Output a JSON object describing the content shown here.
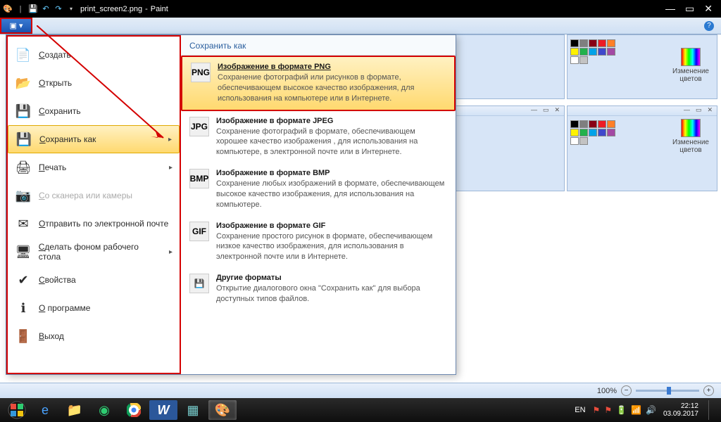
{
  "window": {
    "title_separator": "|",
    "filename": "print_screen2.png",
    "appname": "Paint"
  },
  "qat": {
    "save": "💾",
    "undo": "↶",
    "redo": "↷",
    "customize": "▾"
  },
  "win_controls": {
    "min": "—",
    "max": "▭",
    "close": "✕"
  },
  "file_button": {
    "glyph": "▣ ▾"
  },
  "help_icon": "?",
  "appmenu": {
    "items": [
      {
        "label": "Создать",
        "icon": "📄"
      },
      {
        "label": "Открыть",
        "icon": "📂"
      },
      {
        "label": "Сохранить",
        "icon": "💾"
      },
      {
        "label": "Сохранить как",
        "icon": "💾",
        "selected": true,
        "has_arrow": true
      },
      {
        "label": "Печать",
        "icon": "🖨",
        "has_arrow": true
      },
      {
        "label": "Со сканера или камеры",
        "icon": "📷",
        "disabled": true
      },
      {
        "label": "Отправить по электронной почте",
        "icon": "✉"
      },
      {
        "label": "Сделать фоном рабочего стола",
        "icon": "🖥",
        "has_arrow": true
      },
      {
        "label": "Свойства",
        "icon": "✔"
      },
      {
        "label": "О программе",
        "icon": "ℹ"
      },
      {
        "label": "Выход",
        "icon": "🚪"
      }
    ],
    "sub_header": "Сохранить как",
    "formats": [
      {
        "title": "Изображение в формате PNG",
        "desc": "Сохранение фотографий или рисунков в формате, обеспечивающем высокое качество изображения, для использования на компьютере или в Интернете.",
        "icon": "PNG",
        "selected": true
      },
      {
        "title": "Изображение в формате JPEG",
        "desc": "Сохранение фотографий в формате, обеспечивающем хорошее качество изображения , для использования на компьютере, в электронной почте или в Интернете.",
        "icon": "JPG"
      },
      {
        "title": "Изображение в формате BMP",
        "desc": "Сохранение любых изображений в формате, обеспечивающем высокое качество изображения, для использования на компьютере.",
        "icon": "BMP"
      },
      {
        "title": "Изображение в формате GIF",
        "desc": "Сохранение простого рисунок в формате, обеспечивающем низкое качество изображения, для использования в электронной почте или в Интернете.",
        "icon": "GIF"
      },
      {
        "title": "Другие форматы",
        "desc": "Открытие диалогового окна \"Сохранить как\" для выбора доступных типов файлов.",
        "icon": "💾"
      }
    ]
  },
  "palette": {
    "edit_colors": "Изменение цветов",
    "colors_row1": [
      "#000000",
      "#7f7f7f",
      "#880015",
      "#ed1c24",
      "#ff7f27",
      "#fff200",
      "#22b14c",
      "#00a2e8",
      "#3f48cc",
      "#a349a4"
    ],
    "colors_row2": [
      "#ffffff",
      "#c3c3c3",
      "#b97a57",
      "#ffaec9",
      "#ffc90e",
      "#efe4b0",
      "#b5e61d",
      "#99d9ea",
      "#7092be",
      "#c8bfe7"
    ]
  },
  "statusbar": {
    "zoom_label": "100%"
  },
  "taskbar": {
    "lang": "EN",
    "time": "22:12",
    "date": "03.09.2017"
  }
}
